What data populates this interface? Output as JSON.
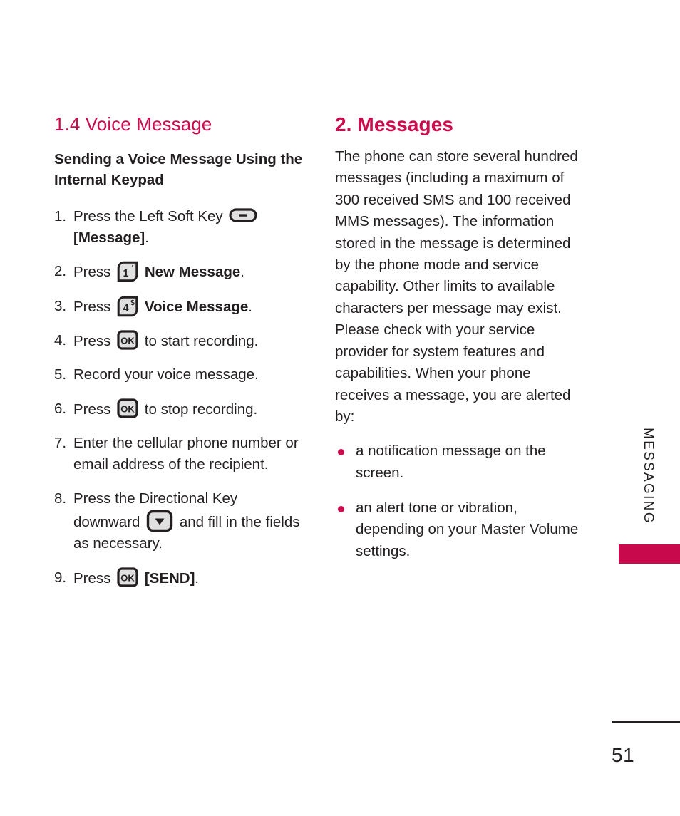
{
  "colors": {
    "accent": "#CB0D4E",
    "tab": "#C80A4D",
    "text": "#231f20",
    "key_fill": "#E0E0E0",
    "key_stroke": "#231f20"
  },
  "left_column": {
    "section_heading": "1.4 Voice Message",
    "sub_heading": "Sending a Voice Message Using the Internal Keypad",
    "steps": [
      {
        "num": "1.",
        "parts": [
          {
            "type": "text",
            "value": "Press the Left Soft Key "
          },
          {
            "type": "icon",
            "value": "left-soft-key-icon"
          },
          {
            "type": "text",
            "value": " "
          },
          {
            "type": "bold",
            "value": "[Message]"
          },
          {
            "type": "text",
            "value": "."
          }
        ]
      },
      {
        "num": "2.",
        "parts": [
          {
            "type": "text",
            "value": "Press "
          },
          {
            "type": "icon",
            "value": "keypad-1-icon"
          },
          {
            "type": "text",
            "value": " "
          },
          {
            "type": "bold",
            "value": "New Message"
          },
          {
            "type": "text",
            "value": "."
          }
        ]
      },
      {
        "num": "3.",
        "parts": [
          {
            "type": "text",
            "value": "Press "
          },
          {
            "type": "icon",
            "value": "keypad-4-icon"
          },
          {
            "type": "text",
            "value": " "
          },
          {
            "type": "bold",
            "value": "Voice Message"
          },
          {
            "type": "text",
            "value": "."
          }
        ]
      },
      {
        "num": "4.",
        "parts": [
          {
            "type": "text",
            "value": "Press "
          },
          {
            "type": "icon",
            "value": "ok-key-icon"
          },
          {
            "type": "text",
            "value": " to start recording."
          }
        ]
      },
      {
        "num": "5.",
        "parts": [
          {
            "type": "text",
            "value": "Record your voice message."
          }
        ]
      },
      {
        "num": "6.",
        "parts": [
          {
            "type": "text",
            "value": "Press "
          },
          {
            "type": "icon",
            "value": "ok-key-icon"
          },
          {
            "type": "text",
            "value": " to stop recording."
          }
        ]
      },
      {
        "num": "7.",
        "parts": [
          {
            "type": "text",
            "value": "Enter the cellular phone number or email address of the recipient."
          }
        ]
      },
      {
        "num": "8.",
        "parts": [
          {
            "type": "text",
            "value": "Press the Directional Key downward "
          },
          {
            "type": "icon",
            "value": "directional-key-down-icon"
          },
          {
            "type": "text",
            "value": " and fill in the fields as necessary."
          }
        ]
      },
      {
        "num": "9.",
        "parts": [
          {
            "type": "text",
            "value": "Press "
          },
          {
            "type": "icon",
            "value": "ok-key-icon"
          },
          {
            "type": "text",
            "value": " "
          },
          {
            "type": "bold",
            "value": "[SEND]"
          },
          {
            "type": "text",
            "value": "."
          }
        ]
      }
    ]
  },
  "right_column": {
    "section_heading": "2. Messages",
    "paragraph": "The phone can store several hundred messages (including a maximum of 300 received SMS and 100 received MMS messages). The information stored in the message is determined by the phone mode and service capability. Other limits to available characters per message may exist. Please check with your service provider for system features and capabilities. When your phone receives a message, you are alerted by:",
    "bullets": [
      "a notification message on the screen.",
      "an alert tone or vibration, depending on your Master Volume settings."
    ]
  },
  "side_tab": {
    "label": "MESSAGING"
  },
  "footer": {
    "page_number": "51"
  },
  "key_glyphs": {
    "keypad_1_main": "1",
    "keypad_1_sup": "'",
    "keypad_4_main": "4",
    "keypad_4_sup": "$",
    "ok_label": "OK"
  }
}
